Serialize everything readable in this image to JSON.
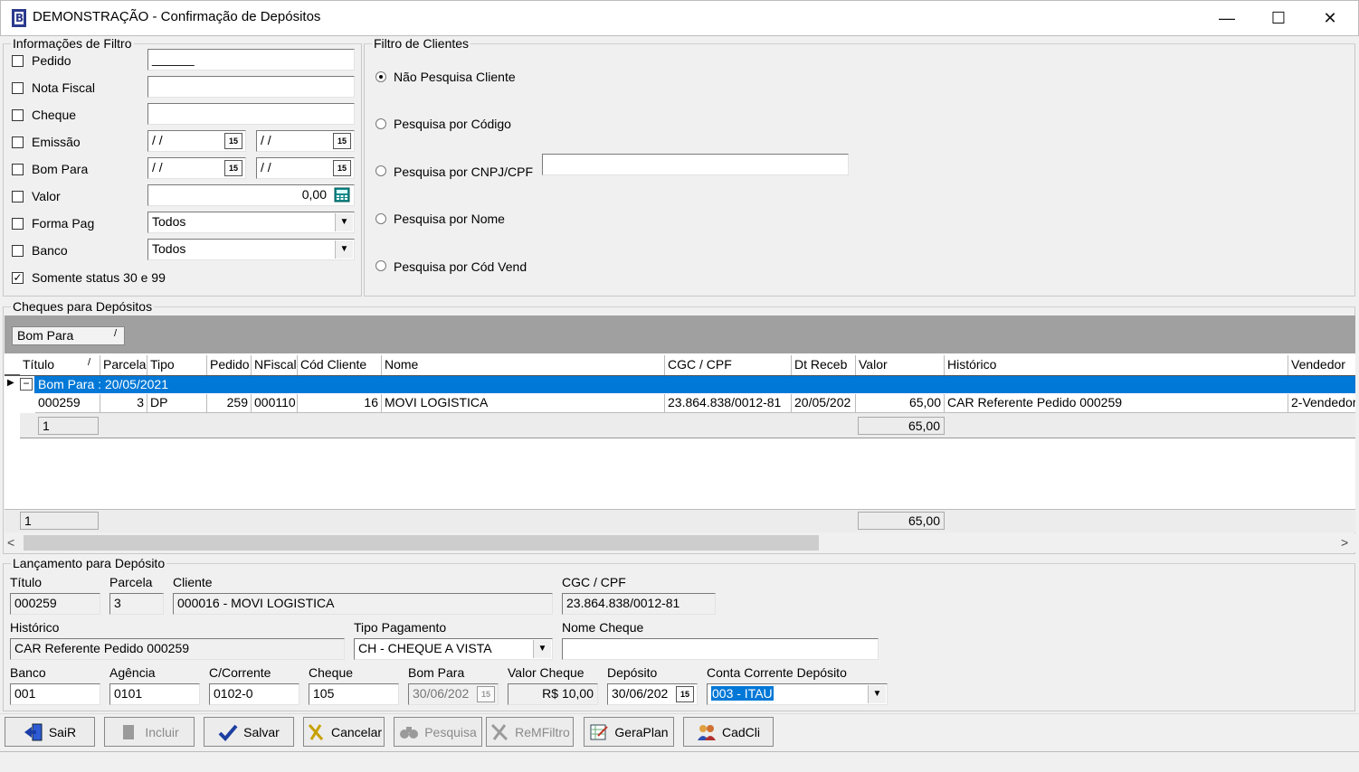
{
  "window": {
    "title": "DEMONSTRAÇÃO - Confirmação de Depósitos",
    "minimize": "—",
    "maximize": "☐",
    "close": "✕"
  },
  "filter": {
    "title": "Informações de Filtro",
    "pedido": {
      "label": "Pedido",
      "checked": false,
      "value": "______"
    },
    "nota_fiscal": {
      "label": "Nota Fiscal",
      "checked": false,
      "value": ""
    },
    "cheque": {
      "label": "Cheque",
      "checked": false,
      "value": ""
    },
    "emissao": {
      "label": "Emissão",
      "checked": false,
      "from": "/ /",
      "to": "/ /"
    },
    "bom_para": {
      "label": "Bom Para",
      "checked": false,
      "from": "/ /",
      "to": "/ /"
    },
    "valor": {
      "label": "Valor",
      "checked": false,
      "value": "0,00"
    },
    "forma_pag": {
      "label": "Forma Pag",
      "checked": false,
      "value": "Todos"
    },
    "banco": {
      "label": "Banco",
      "checked": false,
      "value": "Todos"
    },
    "somente_status": {
      "label": "Somente status 30 e 99",
      "checked": true
    },
    "calendar_glyph": "15"
  },
  "client_filter": {
    "title": "Filtro de Clientes",
    "options": [
      "Não Pesquisa Cliente",
      "Pesquisa por Código",
      "Pesquisa por CNPJ/CPF",
      "Pesquisa por Nome",
      "Pesquisa por Cód Vend"
    ],
    "selected": "Não Pesquisa Cliente",
    "cnpj_value": ""
  },
  "cheques": {
    "title": "Cheques para Depósitos",
    "group_chip": "Bom Para",
    "group_chip_sort": "/",
    "columns": [
      "Título",
      "Parcela",
      "Tipo",
      "Pedido",
      "NFiscal",
      "Cód Cliente",
      "Nome",
      "CGC / CPF",
      "Dt Receb",
      "Valor",
      "Histórico",
      "Vendedor"
    ],
    "titulo_sort": "/",
    "group_row": "Bom Para : 20/05/2021",
    "rows": [
      {
        "titulo": "000259",
        "parcela": "3",
        "tipo": "DP",
        "pedido": "259",
        "nfiscal": "000110",
        "cod_cliente": "16",
        "nome": "MOVI LOGISTICA",
        "cgc": "23.864.838/0012-81",
        "dt_receb": "20/05/202",
        "valor": "65,00",
        "historico": "CAR Referente Pedido 000259",
        "vendedor": "2-Vendedor"
      }
    ],
    "group_count": "1",
    "group_sum": "65,00",
    "footer_count": "1",
    "footer_sum": "65,00"
  },
  "lancamento": {
    "title": "Lançamento para Depósito",
    "titulo": {
      "label": "Título",
      "value": "000259"
    },
    "parcela": {
      "label": "Parcela",
      "value": "3"
    },
    "cliente": {
      "label": "Cliente",
      "value": "000016 - MOVI LOGISTICA"
    },
    "cgc": {
      "label": "CGC / CPF",
      "value": "23.864.838/0012-81"
    },
    "historico": {
      "label": "Histórico",
      "value": "CAR Referente Pedido 000259"
    },
    "tipo_pagamento": {
      "label": "Tipo Pagamento",
      "value": "CH - CHEQUE A VISTA"
    },
    "nome_cheque": {
      "label": "Nome Cheque",
      "value": ""
    },
    "banco": {
      "label": "Banco",
      "value": "001"
    },
    "agencia": {
      "label": "Agência",
      "value": "0101"
    },
    "c_corrente": {
      "label": "C/Corrente",
      "value": "0102-0"
    },
    "cheque": {
      "label": "Cheque",
      "value": "105"
    },
    "bom_para": {
      "label": "Bom Para",
      "value": "30/06/202"
    },
    "valor_cheque": {
      "label": "Valor Cheque",
      "value": "R$ 10,00"
    },
    "deposito": {
      "label": "Depósito",
      "value": "30/06/202"
    },
    "conta_corrente": {
      "label": "Conta Corrente Depósito",
      "value": "003 - ITAU"
    }
  },
  "toolbar": {
    "sair": "SaiR",
    "incluir": "Incluir",
    "salvar": "Salvar",
    "cancelar": "Cancelar",
    "pesquisa": "Pesquisa",
    "remfiltro": "ReMFiltro",
    "geraplan": "GeraPlan",
    "cadcli": "CadCli"
  },
  "colors": {
    "selection": "#0078d7",
    "grid_group_bar": "#a0a0a0"
  }
}
